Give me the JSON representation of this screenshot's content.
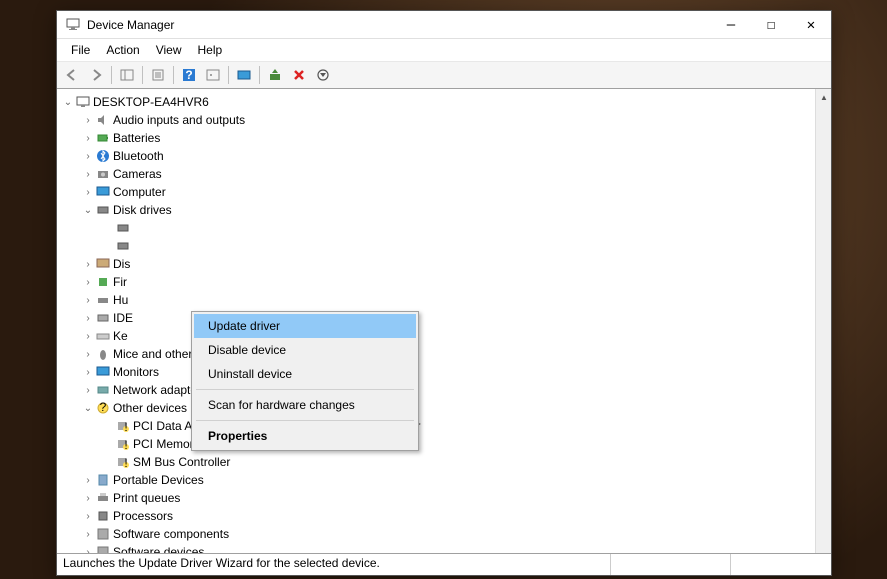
{
  "window": {
    "title": "Device Manager",
    "min": "—",
    "max": "☐",
    "close": "✕"
  },
  "menu": {
    "file": "File",
    "action": "Action",
    "view": "View",
    "help": "Help"
  },
  "tree": {
    "root": "DESKTOP-EA4HVR6",
    "items": [
      {
        "label": "Audio inputs and outputs"
      },
      {
        "label": "Batteries"
      },
      {
        "label": "Bluetooth"
      },
      {
        "label": "Cameras"
      },
      {
        "label": "Computer"
      },
      {
        "label": "Disk drives",
        "expanded": true
      },
      {
        "label": "Dis"
      },
      {
        "label": "Fir"
      },
      {
        "label": "Hu"
      },
      {
        "label": "IDE"
      },
      {
        "label": "Ke"
      },
      {
        "label": "Mice and other pointing devices"
      },
      {
        "label": "Monitors"
      },
      {
        "label": "Network adapters"
      },
      {
        "label": "Other devices",
        "expanded": true
      },
      {
        "label": "Portable Devices"
      },
      {
        "label": "Print queues"
      },
      {
        "label": "Processors"
      },
      {
        "label": "Software components"
      },
      {
        "label": "Software devices"
      }
    ],
    "other_children": [
      "PCI Data Acquisition and Signal Processing Controller",
      "PCI Memory Controller",
      "SM Bus Controller"
    ]
  },
  "context_menu": {
    "update": "Update driver",
    "disable": "Disable device",
    "uninstall": "Uninstall device",
    "scan": "Scan for hardware changes",
    "properties": "Properties"
  },
  "status": "Launches the Update Driver Wizard for the selected device."
}
